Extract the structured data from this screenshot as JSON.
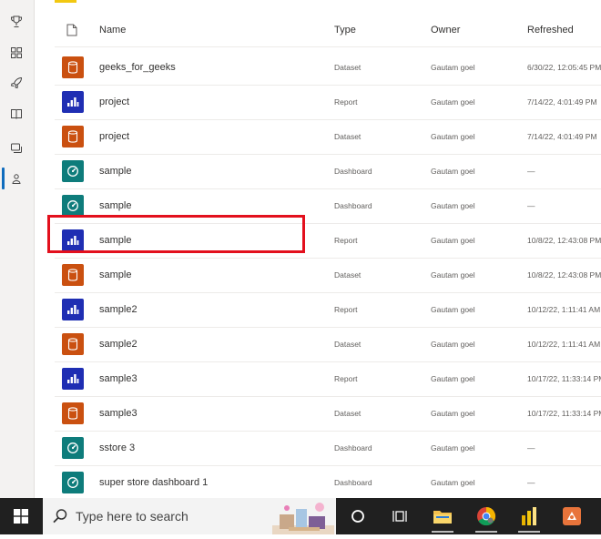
{
  "rail": {
    "icons": [
      "trophy-icon",
      "apps-icon",
      "rocket-icon",
      "book-icon",
      "workspaces-icon",
      "my-workspace-icon"
    ]
  },
  "table": {
    "headers": {
      "name": "Name",
      "type": "Type",
      "owner": "Owner",
      "refreshed": "Refreshed"
    },
    "rows": [
      {
        "kind": "dataset",
        "name": "geeks_for_geeks",
        "type": "Dataset",
        "owner": "Gautam goel",
        "refreshed": "6/30/22, 12:05:45 PM"
      },
      {
        "kind": "report",
        "name": "project",
        "type": "Report",
        "owner": "Gautam goel",
        "refreshed": "7/14/22, 4:01:49 PM"
      },
      {
        "kind": "dataset",
        "name": "project",
        "type": "Dataset",
        "owner": "Gautam goel",
        "refreshed": "7/14/22, 4:01:49 PM"
      },
      {
        "kind": "dashboard",
        "name": "sample",
        "type": "Dashboard",
        "owner": "Gautam goel",
        "refreshed": "—"
      },
      {
        "kind": "dashboard",
        "name": "sample",
        "type": "Dashboard",
        "owner": "Gautam goel",
        "refreshed": "—"
      },
      {
        "kind": "report",
        "name": "sample",
        "type": "Report",
        "owner": "Gautam goel",
        "refreshed": "10/8/22, 12:43:08 PM"
      },
      {
        "kind": "dataset",
        "name": "sample",
        "type": "Dataset",
        "owner": "Gautam goel",
        "refreshed": "10/8/22, 12:43:08 PM"
      },
      {
        "kind": "report",
        "name": "sample2",
        "type": "Report",
        "owner": "Gautam goel",
        "refreshed": "10/12/22, 1:11:41 AM"
      },
      {
        "kind": "dataset",
        "name": "sample2",
        "type": "Dataset",
        "owner": "Gautam goel",
        "refreshed": "10/12/22, 1:11:41 AM"
      },
      {
        "kind": "report",
        "name": "sample3",
        "type": "Report",
        "owner": "Gautam goel",
        "refreshed": "10/17/22, 11:33:14 PM"
      },
      {
        "kind": "dataset",
        "name": "sample3",
        "type": "Dataset",
        "owner": "Gautam goel",
        "refreshed": "10/17/22, 11:33:14 PM"
      },
      {
        "kind": "dashboard",
        "name": "sstore 3",
        "type": "Dashboard",
        "owner": "Gautam goel",
        "refreshed": "—"
      },
      {
        "kind": "dashboard",
        "name": "super store dashboard 1",
        "type": "Dashboard",
        "owner": "Gautam goel",
        "refreshed": "—"
      }
    ]
  },
  "colors": {
    "dataset": "#ca5010",
    "report": "#1f2eb3",
    "dashboard": "#0e7c7b",
    "highlight": "#e3101d"
  },
  "taskbar": {
    "search_placeholder": "Type here to search",
    "apps": [
      "cortana-circle-icon",
      "task-view-icon",
      "file-explorer-icon",
      "chrome-icon",
      "power-bi-icon",
      "app-icon"
    ]
  }
}
